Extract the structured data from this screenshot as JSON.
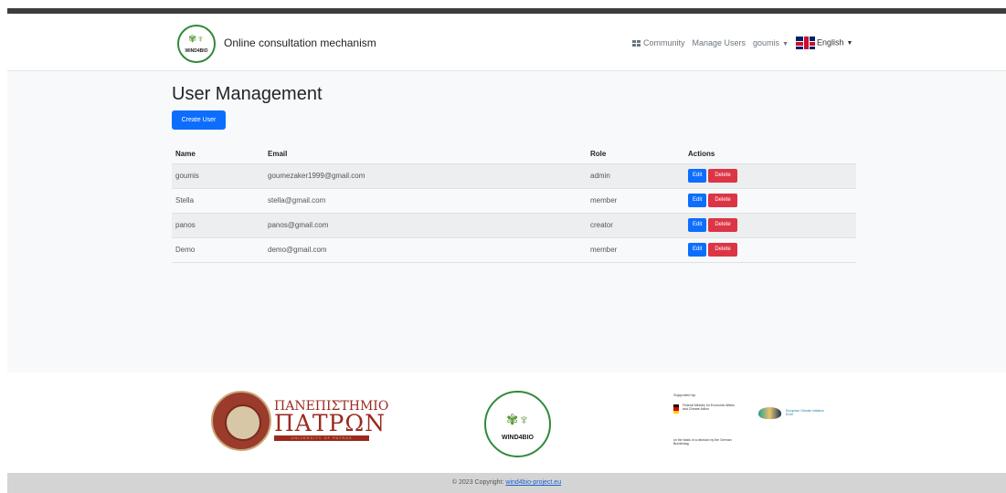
{
  "navbar": {
    "brand_logo_text": "WIND4BIO",
    "brand_name": "Online consultation mechanism",
    "links": {
      "community": "Community",
      "manage_users": "Manage Users",
      "user_menu": "goumis",
      "language": "English"
    }
  },
  "page": {
    "title": "User Management",
    "create_button": "Create User"
  },
  "table": {
    "headers": {
      "name": "Name",
      "email": "Email",
      "role": "Role",
      "actions": "Actions"
    },
    "rows": [
      {
        "name": "goumis",
        "email": "goumezaker1999@gmail.com",
        "role": "admin",
        "edit": "Edit",
        "delete": "Delete"
      },
      {
        "name": "Stella",
        "email": "stella@gmail.com",
        "role": "member",
        "edit": "Edit",
        "delete": "Delete"
      },
      {
        "name": "panos",
        "email": "panos@gmail.com",
        "role": "creator",
        "edit": "Edit",
        "delete": "Delete"
      },
      {
        "name": "Demo",
        "email": "demo@gmail.com",
        "role": "member",
        "edit": "Edit",
        "delete": "Delete"
      }
    ]
  },
  "partners": {
    "university": {
      "line1": "ΠΑΝΕΠΙΣΤΗΜΙΟ",
      "line2": "ΠΑΤΡΩΝ",
      "line3": "UNIVERSITY OF PATRAS"
    },
    "wind4bio_logo_text": "WIND4BIO",
    "supported_by": "Supported by:",
    "ministry": "Federal Ministry for Economic Affairs and Climate Action",
    "parliament": "on the basis of a decision by the German Bundestag",
    "iki": "European Climate Initiative EUKI"
  },
  "footer": {
    "prefix": "© 2023 Copyright:",
    "link_text": "wind4bio-project.eu"
  },
  "colors": {
    "primary": "#0d6efd",
    "danger": "#dc3545",
    "logo_green": "#2f8a3a",
    "university_red": "#9a2a1e"
  }
}
